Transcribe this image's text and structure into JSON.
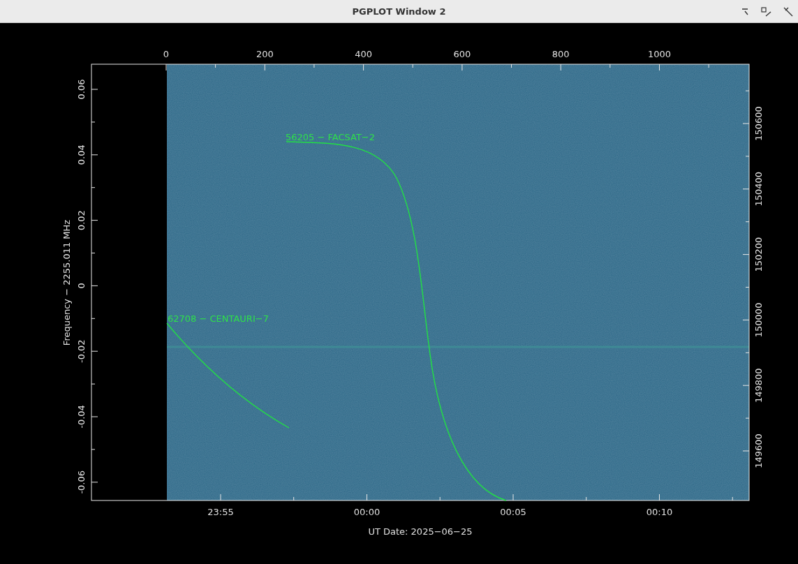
{
  "window": {
    "title": "PGPLOT Window 2"
  },
  "plot": {
    "top_ticks": [
      "0",
      "200",
      "400",
      "600",
      "800",
      "1000"
    ],
    "left_ticks": [
      "0.06",
      "0.04",
      "0.02",
      "0",
      "-0.02",
      "-0.04",
      "-0.06"
    ],
    "right_ticks": [
      "150600",
      "150400",
      "150200",
      "150000",
      "149800",
      "149600"
    ],
    "bottom_ticks": [
      "23:55",
      "00:00",
      "00:05",
      "00:10"
    ],
    "ylabel": "Frequency − 2255.011 MHz",
    "xlabel": "UT Date: 2025−06−25",
    "tracks": [
      {
        "label": "56205 − FACSAT−2"
      },
      {
        "label": "62708 − CENTAURI−7"
      }
    ]
  }
}
